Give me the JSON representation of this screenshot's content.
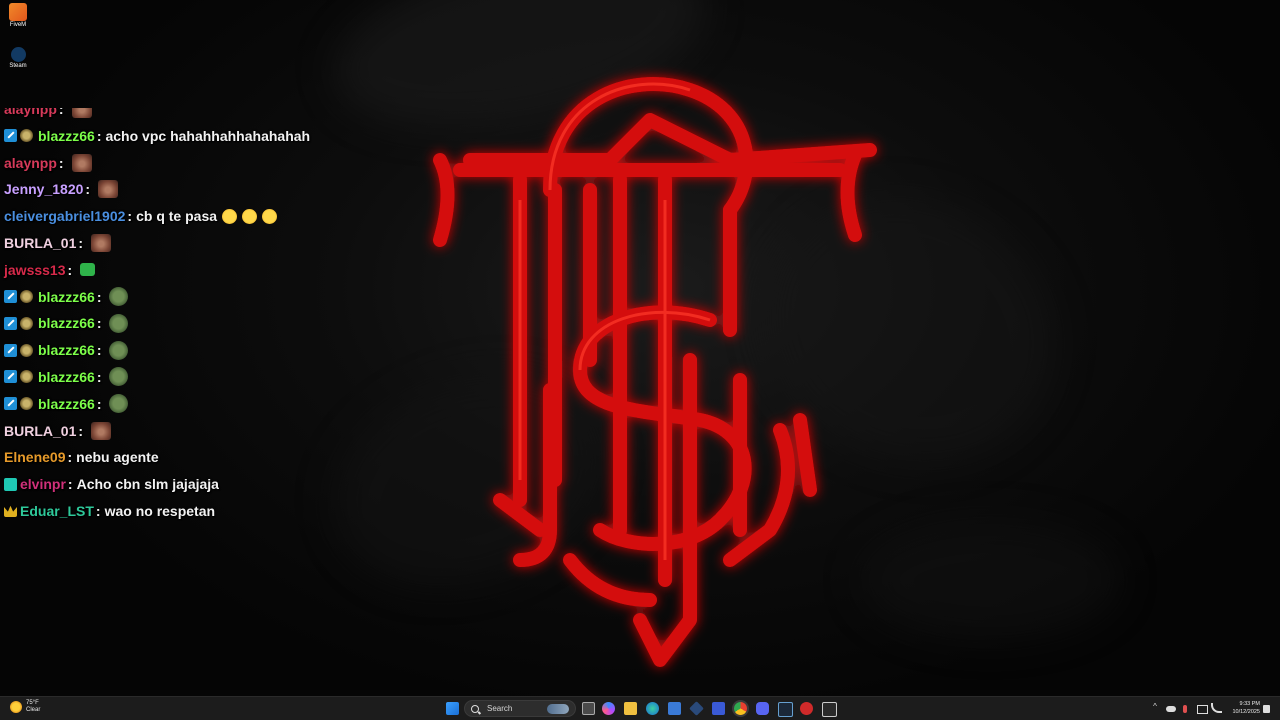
{
  "desktop_icons": [
    {
      "label": "FiveM",
      "icon": "fivem-icon"
    },
    {
      "label": "Steam",
      "icon": "steam-icon"
    }
  ],
  "chat": {
    "messages": [
      {
        "user": "alaynpp",
        "color": "#d63a5a",
        "badges": [],
        "text": "",
        "emote": "face"
      },
      {
        "user": "blazzz66",
        "color": "#7dff4a",
        "badges": [
          "moderator",
          "gift"
        ],
        "text": "acho vpc hahahhahhahahahah",
        "emote": ""
      },
      {
        "user": "alaynpp",
        "color": "#d63a5a",
        "badges": [],
        "text": "",
        "emote": "face"
      },
      {
        "user": "Jenny_1820",
        "color": "#c8a0ff",
        "badges": [],
        "text": "",
        "emote": "face"
      },
      {
        "user": "cleivergabriel1902",
        "color": "#4a8fe0",
        "badges": [],
        "text": "cb q te pasa",
        "emote": "emoji3"
      },
      {
        "user": "BURLA_01",
        "color": "#f0d0e0",
        "badges": [],
        "text": "",
        "emote": "face"
      },
      {
        "user": "jawsss13",
        "color": "#d62a4a",
        "badges": [],
        "text": "",
        "emote": "green"
      },
      {
        "user": "blazzz66",
        "color": "#7dff4a",
        "badges": [
          "moderator",
          "gift"
        ],
        "text": "",
        "emote": "frog"
      },
      {
        "user": "blazzz66",
        "color": "#7dff4a",
        "badges": [
          "moderator",
          "gift"
        ],
        "text": "",
        "emote": "frog"
      },
      {
        "user": "blazzz66",
        "color": "#7dff4a",
        "badges": [
          "moderator",
          "gift"
        ],
        "text": "",
        "emote": "frog"
      },
      {
        "user": "blazzz66",
        "color": "#7dff4a",
        "badges": [
          "moderator",
          "gift"
        ],
        "text": "",
        "emote": "frog"
      },
      {
        "user": "blazzz66",
        "color": "#7dff4a",
        "badges": [
          "moderator",
          "gift"
        ],
        "text": "",
        "emote": "frog"
      },
      {
        "user": "BURLA_01",
        "color": "#f0d0e0",
        "badges": [],
        "text": "",
        "emote": "face"
      },
      {
        "user": "Elnene09",
        "color": "#e69a2a",
        "badges": [],
        "text": "nebu agente",
        "emote": ""
      },
      {
        "user": "elvinpr",
        "color": "#d0307a",
        "badges": [
          "prime"
        ],
        "text": "Acho cbn slm jajajaja",
        "emote": ""
      },
      {
        "user": "Eduar_LST",
        "color": "#2ec99a",
        "badges": [
          "crown"
        ],
        "text": "wao no respetan",
        "emote": ""
      }
    ]
  },
  "taskbar": {
    "weather": {
      "temp": "75°F",
      "condition": "Clear"
    },
    "search_placeholder": "Search",
    "clock": {
      "time": "9:33 PM",
      "date": "10/12/2025"
    },
    "apps": [
      "start-icon",
      "search-icon",
      "task-view-icon",
      "copilot-icon",
      "file-explorer-icon",
      "edge-icon",
      "store-icon",
      "app-icon",
      "app-icon",
      "chrome-icon",
      "discord-icon",
      "steam-icon",
      "app-icon",
      "app-icon"
    ]
  },
  "wallpaper": {
    "accent": "#d40c0c"
  }
}
